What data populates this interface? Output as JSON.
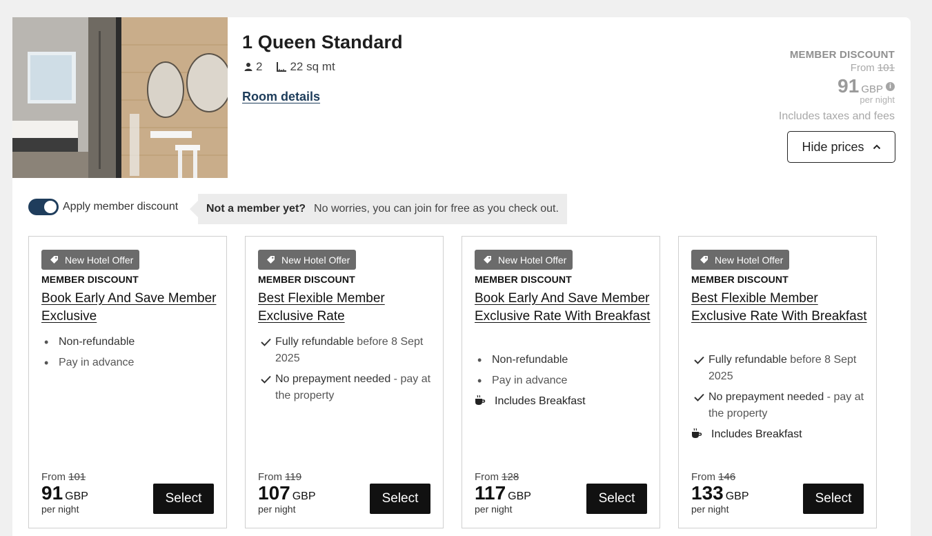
{
  "room": {
    "title": "1 Queen Standard",
    "guests": "2",
    "size": "22 sq mt",
    "details_link": "Room details",
    "photo_icon": "room-photo"
  },
  "price_summary": {
    "label": "MEMBER DISCOUNT",
    "from_text": "From",
    "original": "101",
    "amount": "91",
    "currency": "GBP",
    "info_icon": "info-icon",
    "per_night": "per night",
    "taxes": "Includes taxes and fees",
    "hide_prices": "Hide prices"
  },
  "member": {
    "toggle_on": true,
    "toggle_label": "Apply member discount",
    "hint_bold": "Not a member yet?",
    "hint_text": "No worries, you can join for free as you check out."
  },
  "colors": {
    "accent": "#1f3d5c",
    "badge": "#6b6b6b",
    "button": "#111111"
  },
  "rates": [
    {
      "badge": "New Hotel Offer",
      "label": "MEMBER DISCOUNT",
      "name": "Book Early And Save Member Exclusive",
      "features": [
        {
          "type": "bullet",
          "strong": "Non-refundable",
          "text": ""
        },
        {
          "type": "bullet",
          "strong": "",
          "text": "Pay in advance"
        }
      ],
      "breakfast": "",
      "from_text": "From",
      "original": "101",
      "amount": "91",
      "currency": "GBP",
      "per_night": "per night",
      "select": "Select"
    },
    {
      "badge": "New Hotel Offer",
      "label": "MEMBER DISCOUNT",
      "name": "Best Flexible Member Exclusive Rate",
      "features": [
        {
          "type": "check",
          "strong": "Fully refundable",
          "text": " before 8 Sept 2025"
        },
        {
          "type": "check",
          "strong": "No prepayment needed",
          "text": " - pay at the property"
        }
      ],
      "breakfast": "",
      "from_text": "From",
      "original": "119",
      "amount": "107",
      "currency": "GBP",
      "per_night": "per night",
      "select": "Select"
    },
    {
      "badge": "New Hotel Offer",
      "label": "MEMBER DISCOUNT",
      "name": "Book Early And Save Member Exclusive Rate With Breakfast",
      "features": [
        {
          "type": "bullet",
          "strong": "Non-refundable",
          "text": ""
        },
        {
          "type": "bullet",
          "strong": "",
          "text": "Pay in advance"
        }
      ],
      "breakfast": "Includes Breakfast",
      "from_text": "From",
      "original": "128",
      "amount": "117",
      "currency": "GBP",
      "per_night": "per night",
      "select": "Select"
    },
    {
      "badge": "New Hotel Offer",
      "label": "MEMBER DISCOUNT",
      "name": "Best Flexible Member Exclusive Rate With Breakfast",
      "features": [
        {
          "type": "check",
          "strong": "Fully refundable",
          "text": " before 8 Sept 2025"
        },
        {
          "type": "check",
          "strong": "No prepayment needed",
          "text": " - pay at the property"
        }
      ],
      "breakfast": "Includes Breakfast",
      "from_text": "From",
      "original": "146",
      "amount": "133",
      "currency": "GBP",
      "per_night": "per night",
      "select": "Select"
    }
  ]
}
